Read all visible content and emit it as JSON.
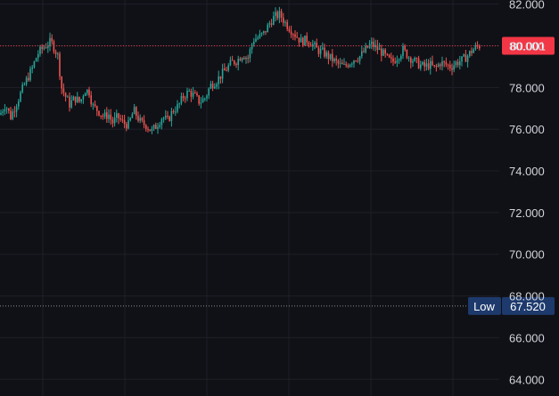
{
  "chart_data": {
    "type": "candlestick",
    "theme": {
      "background": "#101116",
      "grid": "#1e2028",
      "text": "#d1d4dc"
    },
    "colors": {
      "up": "#26a69a",
      "down": "#ef5350"
    },
    "y_axis": {
      "ticks": [
        "82.000",
        "80.000",
        "78.000",
        "76.000",
        "74.000",
        "72.000",
        "70.000",
        "68.000",
        "66.000",
        "64.000"
      ],
      "tick_values": [
        82,
        80,
        78,
        76,
        74,
        72,
        70,
        68,
        66,
        64
      ],
      "range": [
        63.2,
        82.2
      ]
    },
    "price_line": {
      "value": 80.001,
      "label": "80.001",
      "color": "#f23645"
    },
    "low_line": {
      "title": "Low",
      "value": 67.52,
      "label": "67.520",
      "color": "#1e3a6d"
    },
    "close_path": [
      [
        0,
        76.7
      ],
      [
        6,
        77.2
      ],
      [
        12,
        76.6
      ],
      [
        20,
        77.4
      ],
      [
        28,
        78.2
      ],
      [
        36,
        78.9
      ],
      [
        42,
        79.6
      ],
      [
        48,
        79.9
      ],
      [
        54,
        80.1
      ],
      [
        57,
        80.2
      ],
      [
        62,
        79.8
      ],
      [
        66,
        79.4
      ],
      [
        68,
        78.1
      ],
      [
        72,
        77.7
      ],
      [
        78,
        77.2
      ],
      [
        84,
        77.5
      ],
      [
        90,
        77.3
      ],
      [
        95,
        77.9
      ],
      [
        100,
        77.8
      ],
      [
        104,
        77.1
      ],
      [
        110,
        76.9
      ],
      [
        116,
        76.6
      ],
      [
        122,
        76.7
      ],
      [
        126,
        76.3
      ],
      [
        132,
        76.6
      ],
      [
        138,
        76.3
      ],
      [
        144,
        76.2
      ],
      [
        150,
        76.9
      ],
      [
        154,
        76.6
      ],
      [
        158,
        76.3
      ],
      [
        164,
        76.2
      ],
      [
        170,
        75.9
      ],
      [
        176,
        76.2
      ],
      [
        182,
        76.6
      ],
      [
        188,
        76.4
      ],
      [
        194,
        76.9
      ],
      [
        200,
        77.1
      ],
      [
        206,
        77.6
      ],
      [
        212,
        77.8
      ],
      [
        218,
        77.6
      ],
      [
        224,
        77.3
      ],
      [
        230,
        77.5
      ],
      [
        236,
        78.1
      ],
      [
        242,
        78.3
      ],
      [
        248,
        78.6
      ],
      [
        254,
        78.9
      ],
      [
        260,
        79.2
      ],
      [
        266,
        79.3
      ],
      [
        272,
        79.6
      ],
      [
        278,
        79.4
      ],
      [
        284,
        80.3
      ],
      [
        290,
        80.4
      ],
      [
        296,
        80.6
      ],
      [
        300,
        80.9
      ],
      [
        304,
        81.2
      ],
      [
        308,
        81.4
      ],
      [
        314,
        81.5
      ],
      [
        320,
        81.1
      ],
      [
        326,
        80.8
      ],
      [
        332,
        80.5
      ],
      [
        338,
        80.2
      ],
      [
        344,
        80.3
      ],
      [
        350,
        80.1
      ],
      [
        356,
        79.8
      ],
      [
        362,
        79.7
      ],
      [
        368,
        79.5
      ],
      [
        374,
        79.3
      ],
      [
        380,
        79.1
      ],
      [
        386,
        79.0
      ],
      [
        392,
        79.2
      ],
      [
        398,
        79.4
      ],
      [
        404,
        79.5
      ],
      [
        410,
        79.8
      ],
      [
        416,
        80.1
      ],
      [
        422,
        79.9
      ],
      [
        428,
        79.7
      ],
      [
        434,
        79.4
      ],
      [
        440,
        79.2
      ],
      [
        446,
        79.5
      ],
      [
        452,
        79.8
      ],
      [
        458,
        79.5
      ],
      [
        464,
        79.3
      ],
      [
        470,
        79.1
      ],
      [
        476,
        79.0
      ],
      [
        482,
        79.1
      ],
      [
        488,
        78.9
      ],
      [
        494,
        79.2
      ],
      [
        500,
        79.1
      ],
      [
        506,
        79.0
      ],
      [
        512,
        79.2
      ],
      [
        518,
        79.3
      ],
      [
        524,
        79.5
      ],
      [
        530,
        79.8
      ],
      [
        536,
        80.0
      ],
      [
        538,
        80.0
      ]
    ]
  }
}
